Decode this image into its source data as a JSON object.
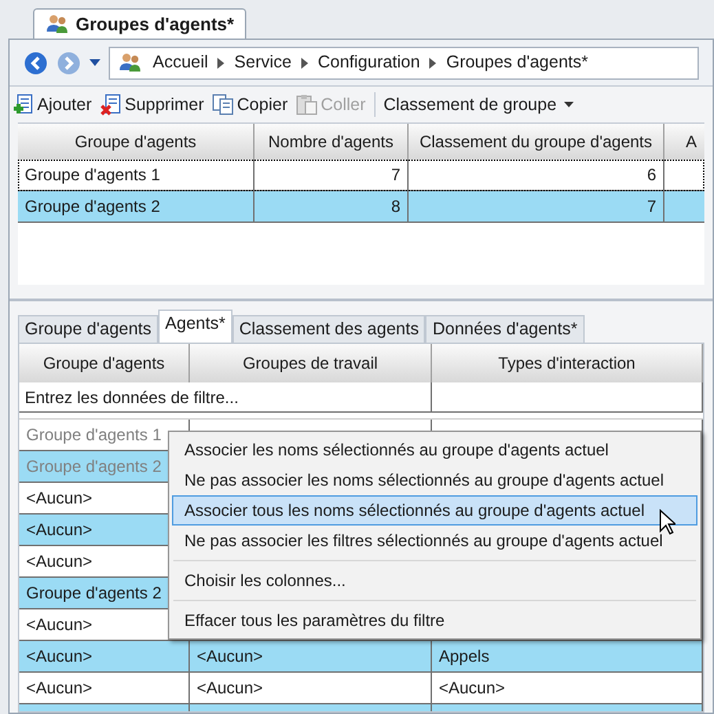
{
  "document_tab": {
    "title": "Groupes d'agents*"
  },
  "breadcrumb": [
    "Accueil",
    "Service",
    "Configuration",
    "Groupes d'agents*"
  ],
  "toolbar": [
    {
      "label": "Ajouter",
      "kind": "add",
      "disabled": false
    },
    {
      "label": "Supprimer",
      "kind": "delete",
      "disabled": false
    },
    {
      "label": "Copier",
      "kind": "copy",
      "disabled": false
    },
    {
      "label": "Coller",
      "kind": "paste",
      "disabled": true
    },
    {
      "label": "Classement de groupe",
      "kind": "dropdown",
      "disabled": false
    }
  ],
  "groups_table": {
    "columns": [
      "Groupe d'agents",
      "Nombre d'agents",
      "Classement du groupe d'agents",
      "A"
    ],
    "rows": [
      {
        "cells": [
          "Groupe d'agents 1",
          "7",
          "6",
          ""
        ],
        "selected": false
      },
      {
        "cells": [
          "Groupe d'agents 2",
          "8",
          "7",
          ""
        ],
        "selected": true
      }
    ]
  },
  "detail_tabs": [
    {
      "label": "Groupe d'agents",
      "selected": false
    },
    {
      "label": "Agents*",
      "selected": true
    },
    {
      "label": "Classement des agents",
      "selected": false
    },
    {
      "label": "Données d'agents*",
      "selected": false
    }
  ],
  "agents_table": {
    "columns": [
      "Groupe d'agents",
      "Groupes de travail",
      "Types d'interaction"
    ],
    "filter_placeholder": "Entrez les données de filtre...",
    "rows": [
      {
        "cells": [
          "Groupe d'agents 1",
          "",
          ""
        ],
        "selected": false,
        "disabled": true
      },
      {
        "cells": [
          "Groupe d'agents 2",
          "",
          ""
        ],
        "selected": true,
        "disabled": true
      },
      {
        "cells": [
          "<Aucun>",
          "",
          ""
        ],
        "selected": false,
        "disabled": false
      },
      {
        "cells": [
          "<Aucun>",
          "",
          ""
        ],
        "selected": true,
        "disabled": false
      },
      {
        "cells": [
          "<Aucun>",
          "",
          ""
        ],
        "selected": false,
        "disabled": false
      },
      {
        "cells": [
          "Groupe d'agents 2",
          "",
          ""
        ],
        "selected": true,
        "disabled": false
      },
      {
        "cells": [
          "<Aucun>",
          "",
          ""
        ],
        "selected": false,
        "disabled": false
      },
      {
        "cells": [
          "<Aucun>",
          "<Aucun>",
          "Appels"
        ],
        "selected": true,
        "disabled": false
      },
      {
        "cells": [
          "<Aucun>",
          "<Aucun>",
          "<Aucun>"
        ],
        "selected": false,
        "disabled": false
      },
      {
        "cells": [
          "",
          "",
          ""
        ],
        "selected": true,
        "disabled": false
      }
    ]
  },
  "context_menu": [
    {
      "label": "Associer les noms sélectionnés au groupe d'agents actuel",
      "selected": false,
      "separator_before": false
    },
    {
      "label": "Ne pas associer les noms sélectionnés au groupe d'agents actuel",
      "selected": false,
      "separator_before": false
    },
    {
      "label": "Associer tous les noms sélectionnés au groupe d'agents actuel",
      "selected": true,
      "separator_before": false
    },
    {
      "label": "Ne pas associer les filtres sélectionnés au groupe d'agents actuel",
      "selected": false,
      "separator_before": false
    },
    {
      "label": "Choisir les colonnes...",
      "selected": false,
      "separator_before": true
    },
    {
      "label": "Effacer tous les paramètres du filtre",
      "selected": false,
      "separator_before": true
    }
  ]
}
